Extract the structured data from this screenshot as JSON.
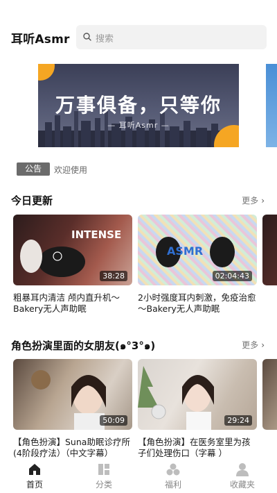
{
  "header": {
    "app_title": "耳听Asmr",
    "search_placeholder": "搜索"
  },
  "banner": {
    "title": "万事俱备，只等你",
    "subtitle": "— 耳听Asmr —"
  },
  "notice": {
    "tag": "公告",
    "text": "欢迎使用"
  },
  "sections": [
    {
      "title": "今日更新",
      "more": "更多",
      "cards": [
        {
          "title": "粗暴耳内清洁 颅内直升机～Bakery无人声助眠",
          "duration": "38:28",
          "overlay": "INTENSE"
        },
        {
          "title": "2小时强度耳内刺激，免疫治愈～Bakery无人声助眠",
          "duration": "02:04:43",
          "overlay": "ASMR"
        }
      ]
    },
    {
      "title": "角色扮演里面的女朋友(๑°3°๑)",
      "more": "更多",
      "cards": [
        {
          "title": "【角色扮演】Suna助眠诊疗所(4阶段疗法）（中文字幕）",
          "duration": "50:09"
        },
        {
          "title": "【角色扮演】在医务室里为孩子们处理伤口（字幕 ）",
          "duration": "29:24"
        }
      ]
    }
  ],
  "tabbar": {
    "items": [
      {
        "label": "首页",
        "icon": "home-icon",
        "active": true
      },
      {
        "label": "分类",
        "icon": "category-icon",
        "active": false
      },
      {
        "label": "福利",
        "icon": "welfare-icon",
        "active": false
      },
      {
        "label": "收藏夹",
        "icon": "user-icon",
        "active": false
      }
    ]
  },
  "colors": {
    "accent": "#f5a623",
    "notice_tag": "#6b6b6b",
    "search_bg": "#f2f2f2"
  }
}
